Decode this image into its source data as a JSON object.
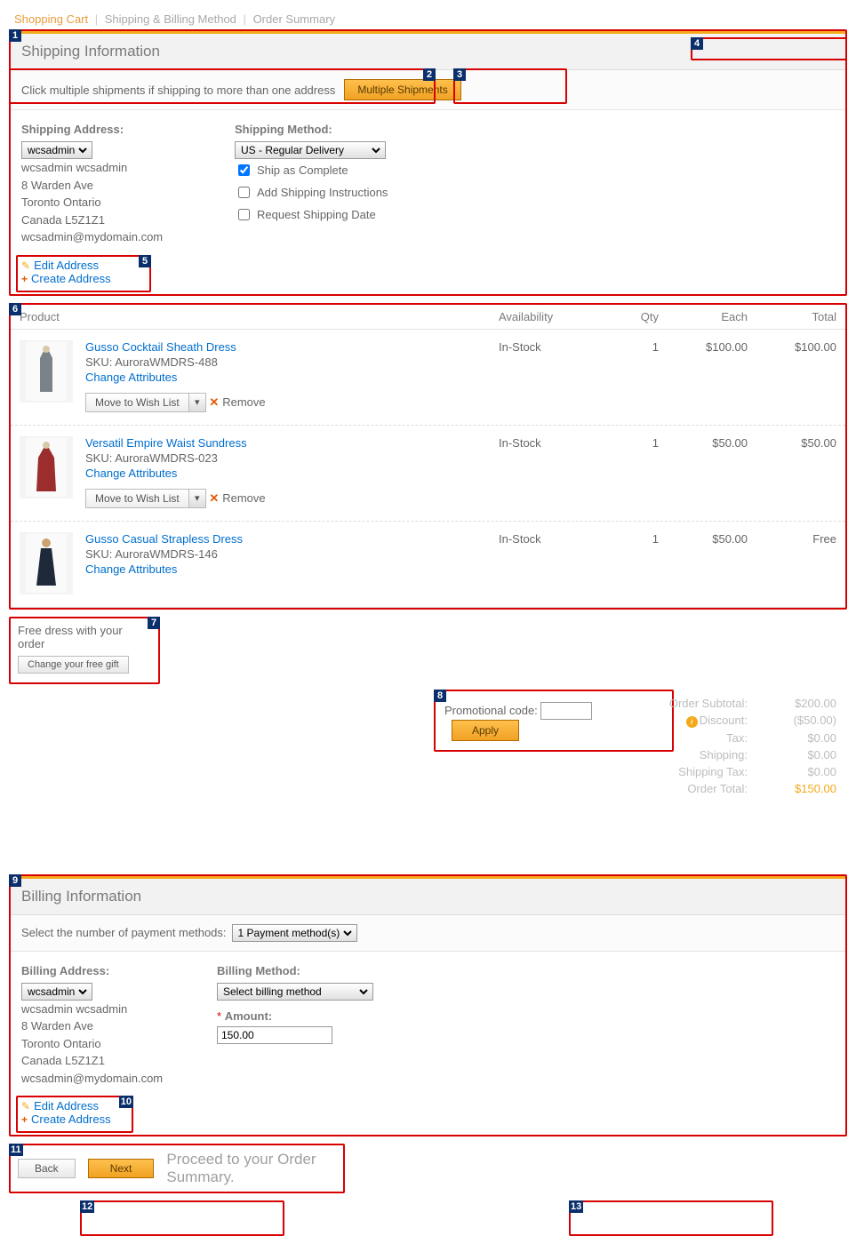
{
  "breadcrumb": {
    "cart": "Shopping Cart",
    "ship": "Shipping & Billing Method",
    "summary": "Order Summary"
  },
  "shipping": {
    "title": "Shipping Information",
    "multi_msg": "Click multiple shipments if shipping to more than one address",
    "multi_btn": "Multiple Shipments",
    "addr_label": "Shipping Address:",
    "addr_select": "wcsadmin",
    "addr": {
      "name": "wcsadmin wcsadmin",
      "street": "8 Warden Ave",
      "city": "Toronto Ontario",
      "country": "Canada L5Z1Z1",
      "email": "wcsadmin@mydomain.com"
    },
    "edit": "Edit Address",
    "create": "Create Address",
    "method_label": "Shipping Method:",
    "method_select": "US - Regular Delivery",
    "ship_complete": "Ship as Complete",
    "add_instr": "Add Shipping Instructions",
    "req_date": "Request Shipping Date"
  },
  "products": {
    "headers": {
      "product": "Product",
      "avail": "Availability",
      "qty": "Qty",
      "each": "Each",
      "total": "Total"
    },
    "items": [
      {
        "name": "Gusso Cocktail Sheath Dress",
        "sku": "SKU: AuroraWMDRS-488",
        "change": "Change Attributes",
        "wish": "Move to Wish List",
        "remove": "Remove",
        "avail": "In-Stock",
        "qty": "1",
        "each": "$100.00",
        "total": "$100.00"
      },
      {
        "name": "Versatil Empire Waist Sundress",
        "sku": "SKU: AuroraWMDRS-023",
        "change": "Change Attributes",
        "wish": "Move to Wish List",
        "remove": "Remove",
        "avail": "In-Stock",
        "qty": "1",
        "each": "$50.00",
        "total": "$50.00"
      },
      {
        "name": "Gusso Casual Strapless Dress",
        "sku": "SKU: AuroraWMDRS-146",
        "change": "Change Attributes",
        "avail": "In-Stock",
        "qty": "1",
        "each": "$50.00",
        "total": "Free"
      }
    ]
  },
  "free_gift": {
    "msg": "Free dress with your order",
    "btn": "Change your free gift"
  },
  "promo": {
    "label": "Promotional code:",
    "apply": "Apply"
  },
  "totals": {
    "subtotal_l": "Order Subtotal:",
    "subtotal_v": "$200.00",
    "discount_l": "Discount:",
    "discount_v": "($50.00)",
    "tax_l": "Tax:",
    "tax_v": "$0.00",
    "shipping_l": "Shipping:",
    "shipping_v": "$0.00",
    "shiptax_l": "Shipping Tax:",
    "shiptax_v": "$0.00",
    "total_l": "Order Total:",
    "total_v": "$150.00"
  },
  "billing": {
    "title": "Billing Information",
    "num_methods_l": "Select the number of payment methods:",
    "num_methods_v": "1 Payment method(s)",
    "addr_label": "Billing Address:",
    "addr_select": "wcsadmin",
    "addr": {
      "name": "wcsadmin wcsadmin",
      "street": "8 Warden Ave",
      "city": "Toronto Ontario",
      "country": "Canada L5Z1Z1",
      "email": "wcsadmin@mydomain.com"
    },
    "edit": "Edit Address",
    "create": "Create Address",
    "method_label": "Billing Method:",
    "method_select": "Select billing method",
    "amount_l": "Amount:",
    "amount_v": "150.00"
  },
  "actions": {
    "back": "Back",
    "next": "Next",
    "hint": "Proceed to your Order Summary."
  }
}
